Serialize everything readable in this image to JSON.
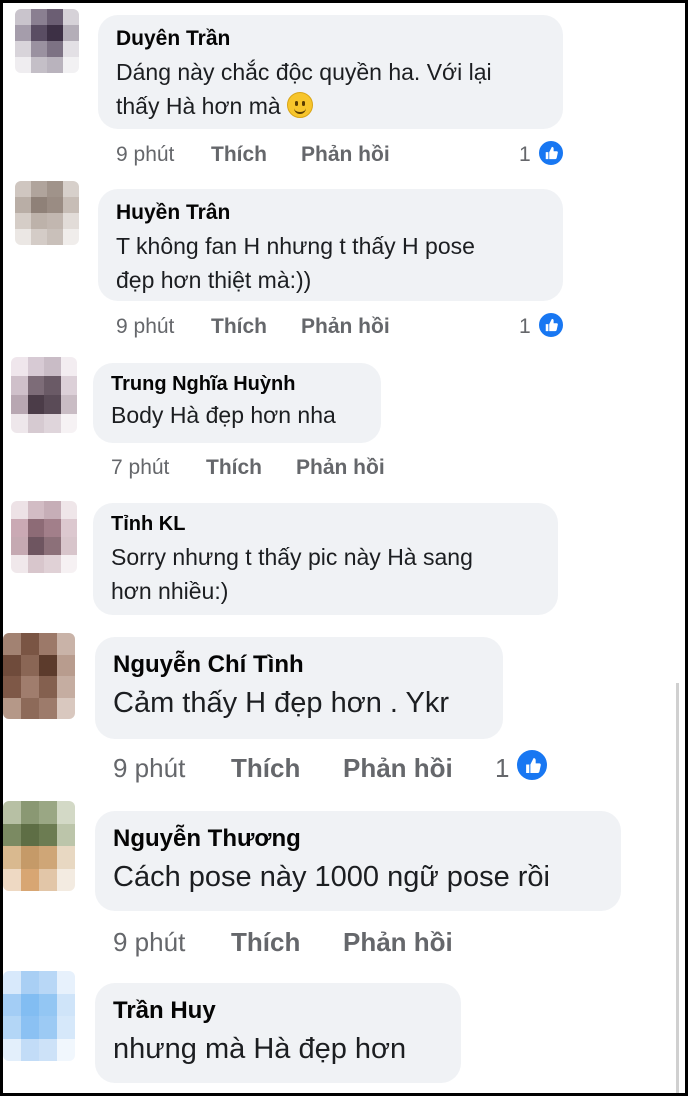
{
  "comments": [
    {
      "name": "Duyên Trần",
      "line1": "Dáng này chắc độc quyền ha. Với lại",
      "line2": "thấy Hà hơn mà",
      "emoji": "smile-emoji",
      "time": "9 phút",
      "like": "Thích",
      "reply": "Phản hồi",
      "likes": "1"
    },
    {
      "name": "Huyền Trân",
      "line1": "T không fan H nhưng t thấy H pose",
      "line2": "đẹp hơn thiệt mà:))",
      "time": "9 phút",
      "like": "Thích",
      "reply": "Phản hồi",
      "likes": "1"
    },
    {
      "name": "Trung Nghĩa Huỳnh",
      "line1": "Body Hà đẹp hơn nha",
      "time": "7 phút",
      "like": "Thích",
      "reply": "Phản hồi"
    },
    {
      "name": "Tỉnh KL",
      "line1": "Sorry nhưng t thấy pic này Hà sang",
      "line2": "hơn nhiều:)"
    },
    {
      "name": "Nguyễn Chí Tình",
      "line1": "Cảm thấy H đẹp hơn . Ykr",
      "time": "9 phút",
      "like": "Thích",
      "reply": "Phản hồi",
      "likes": "1"
    },
    {
      "name": "Nguyễn Thương",
      "line1": "Cách pose này 1000 ngữ pose rồi",
      "time": "9 phút",
      "like": "Thích",
      "reply": "Phản hồi"
    },
    {
      "name": "Trần Huy",
      "line1": "nhưng mà Hà đẹp hơn"
    }
  ],
  "colors": {
    "bubble": "#f0f2f5",
    "action": "#65676b",
    "like_blue": "#1877f2"
  },
  "icons": {
    "like": "thumbs-up-icon"
  }
}
